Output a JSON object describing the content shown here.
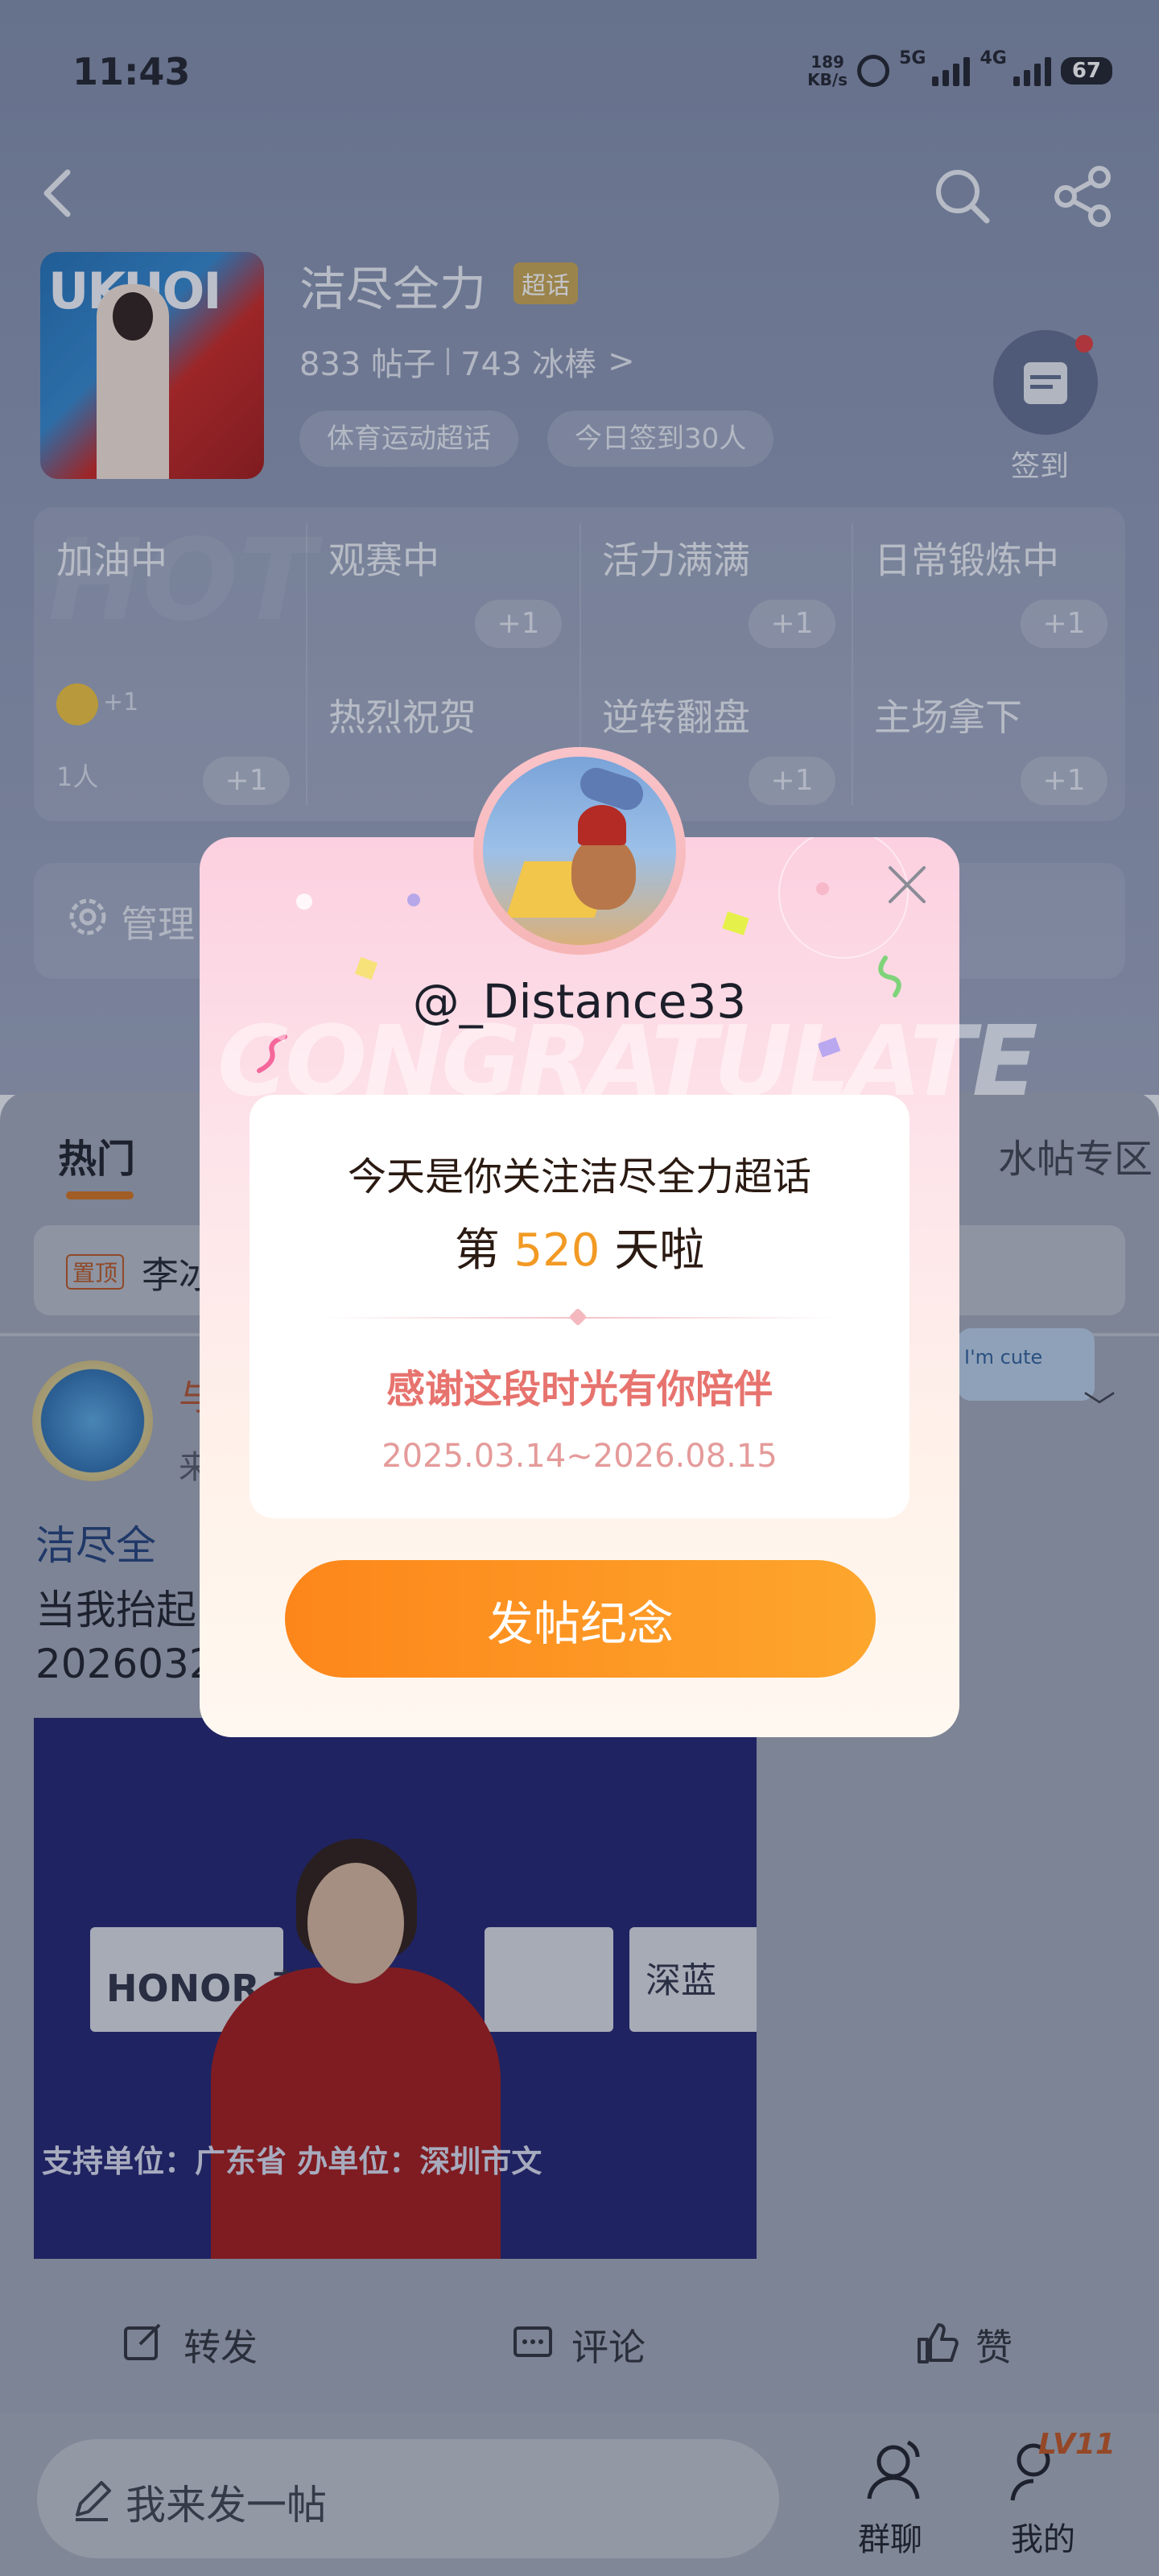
{
  "status_bar": {
    "time": "11:43",
    "speed_value": "189",
    "speed_unit": "KB/s",
    "net1": "5G",
    "net2": "4G",
    "battery": "67"
  },
  "header": {
    "title": "洁尽全力",
    "badge": "超话",
    "posts": "833 帖子",
    "fans": "743 冰棒",
    "chevron": ">",
    "tags": [
      "体育运动超话",
      "今日签到30人"
    ],
    "checkin_label": "签到"
  },
  "grid": {
    "watermark": "HOT",
    "cells": [
      {
        "label": "加油中",
        "plus": ""
      },
      {
        "label": "观赛中",
        "plus": "+1"
      },
      {
        "label": "活力满满",
        "plus": "+1"
      },
      {
        "label": "日常锻炼中",
        "plus": "+1"
      },
      {
        "label": "+1",
        "plus": "+1"
      },
      {
        "label": "热烈祝贺",
        "plus": ""
      },
      {
        "label": "逆转翻盘",
        "plus": "+1"
      },
      {
        "label": "主场拿下",
        "plus": "+1"
      }
    ],
    "crowd": "1人"
  },
  "manage": {
    "label": "管理"
  },
  "tabs": {
    "hot": "热门",
    "water": "水帖专区"
  },
  "pinned": {
    "tag": "置顶",
    "text": "李冰"
  },
  "post": {
    "name": "与",
    "sub": "来",
    "sticker": "I'm cute",
    "expand": "﹀",
    "topic": "洁尽全",
    "line1": "当我抬起",
    "line2": "2026032",
    "photo_sign": "HONOR 荣",
    "photo_sz": "深蓝",
    "photo_sub": "支持单位：广东省    办单位：深圳市文",
    "actions": {
      "repost": "转发",
      "comment": "评论",
      "like": "赞"
    }
  },
  "bottom": {
    "compose": "我来发一帖",
    "group": "群聊",
    "mine": "我的",
    "level": "LV11"
  },
  "modal": {
    "watermark": "CONGRATULATE",
    "username": "@_Distance33",
    "line1": "今天是你关注洁尽全力超话",
    "day_prefix": "第 ",
    "day_count": "520",
    "day_suffix": " 天啦",
    "thanks": "感谢这段时光有你陪伴",
    "dates": "2025.03.14~2026.08.15",
    "cta": "发帖纪念",
    "colors": {
      "accent": "#fd861a",
      "number": "#f29a24",
      "thanks": "#e7736e"
    }
  }
}
